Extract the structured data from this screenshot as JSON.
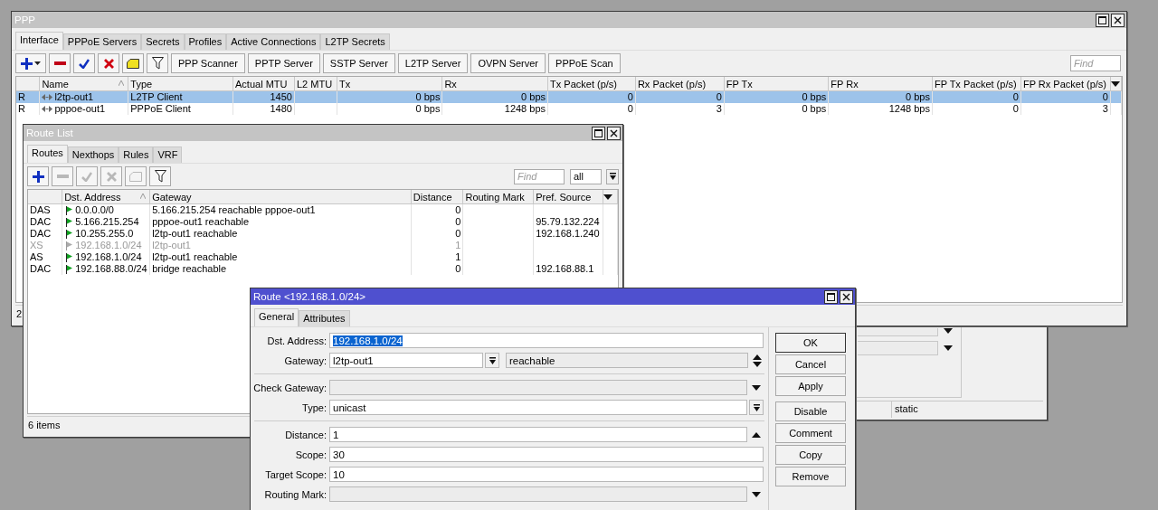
{
  "ppp_window": {
    "title": "PPP",
    "tabs": [
      {
        "label": "Interface",
        "selected": true
      },
      {
        "label": "PPPoE Servers",
        "selected": false
      },
      {
        "label": "Secrets",
        "selected": false
      },
      {
        "label": "Profiles",
        "selected": false
      },
      {
        "label": "Active Connections",
        "selected": false
      },
      {
        "label": "L2TP Secrets",
        "selected": false
      }
    ],
    "tools": [
      {
        "kind": "add_menu",
        "disabled": false
      },
      {
        "kind": "remove",
        "disabled": false
      },
      {
        "kind": "enable",
        "disabled": false
      },
      {
        "kind": "disable",
        "disabled": false
      },
      {
        "kind": "comment",
        "disabled": false
      },
      {
        "kind": "filter",
        "disabled": false
      }
    ],
    "buttons": [
      "PPP Scanner",
      "PPTP Server",
      "SSTP Server",
      "L2TP Server",
      "OVPN Server",
      "PPPoE Scan"
    ],
    "find": {
      "placeholder": "Find"
    },
    "table": {
      "columns": [
        {
          "label": "Name",
          "sorted": true
        },
        {
          "label": "Type",
          "sorted": false
        },
        {
          "label": "Actual MTU",
          "sorted": false
        },
        {
          "label": "L2 MTU",
          "sorted": false
        },
        {
          "label": "Tx",
          "sorted": false
        },
        {
          "label": "Rx",
          "sorted": false
        },
        {
          "label": "Tx Packet (p/s)",
          "sorted": false
        },
        {
          "label": "Rx Packet (p/s)",
          "sorted": false
        },
        {
          "label": "FP Tx",
          "sorted": false
        },
        {
          "label": "FP Rx",
          "sorted": false
        },
        {
          "label": "FP Tx Packet (p/s)",
          "sorted": false
        },
        {
          "label": "FP Rx Packet (p/s)",
          "sorted": false
        }
      ],
      "rows": [
        {
          "selected": true,
          "flag": "R",
          "name": "l2tp-out1",
          "type": "L2TP Client",
          "actual_mtu": "1450",
          "tx": "0 bps",
          "rx": "0 bps",
          "tx_packet": "0",
          "rx_packet": "0",
          "fp_tx": "0 bps",
          "fp_rx": "0 bps",
          "fp_tx_packet": "0",
          "fp_rx_packet": "0"
        },
        {
          "selected": false,
          "flag": "R",
          "name": "pppoe-out1",
          "type": "PPPoE Client",
          "actual_mtu": "1480",
          "tx": "0 bps",
          "rx": "1248 bps",
          "tx_packet": "0",
          "rx_packet": "3",
          "fp_tx": "0 bps",
          "fp_rx": "1248 bps",
          "fp_tx_packet": "0",
          "fp_rx_packet": "3"
        }
      ]
    },
    "status": "2"
  },
  "background_window": {
    "status": "static"
  },
  "route_list": {
    "title": "Route List",
    "tabs": [
      {
        "label": "Routes",
        "selected": true
      },
      {
        "label": "Nexthops",
        "selected": false
      },
      {
        "label": "Rules",
        "selected": false
      },
      {
        "label": "VRF",
        "selected": false
      }
    ],
    "tools": [
      {
        "kind": "add",
        "disabled": false
      },
      {
        "kind": "remove",
        "disabled": true
      },
      {
        "kind": "enable",
        "disabled": true
      },
      {
        "kind": "disable",
        "disabled": true
      },
      {
        "kind": "comment",
        "disabled": true
      },
      {
        "kind": "filter",
        "disabled": false
      }
    ],
    "find": {
      "placeholder": "Find"
    },
    "filter_value": "all",
    "table": {
      "columns": [
        {
          "label": "Dst. Address",
          "sorted": true
        },
        {
          "label": "Gateway",
          "sorted": false
        },
        {
          "label": "Distance",
          "sorted": false
        },
        {
          "label": "Routing Mark",
          "sorted": false
        },
        {
          "label": "Pref. Source",
          "sorted": false
        }
      ],
      "rows": [
        {
          "selected": false,
          "disabled": false,
          "flags": "DAS",
          "dst_address": "0.0.0.0/0",
          "gateway": "5.166.215.254 reachable pppoe-out1",
          "distance": "0"
        },
        {
          "selected": false,
          "disabled": false,
          "flags": "DAC",
          "dst_address": "5.166.215.254",
          "gateway": "pppoe-out1 reachable",
          "distance": "0",
          "pref_source": "95.79.132.224"
        },
        {
          "selected": false,
          "disabled": false,
          "flags": "DAC",
          "dst_address": "10.255.255.0",
          "gateway": "l2tp-out1 reachable",
          "distance": "0",
          "pref_source": "192.168.1.240"
        },
        {
          "selected": false,
          "disabled": true,
          "flags": "XS",
          "dst_address": "192.168.1.0/24",
          "gateway": "l2tp-out1",
          "distance": "1"
        },
        {
          "selected": false,
          "disabled": false,
          "flags": "AS",
          "dst_address": "192.168.1.0/24",
          "gateway": "l2tp-out1 reachable",
          "distance": "1"
        },
        {
          "selected": false,
          "disabled": false,
          "flags": "DAC",
          "dst_address": "192.168.88.0/24",
          "gateway": "bridge reachable",
          "distance": "0",
          "pref_source": "192.168.88.1"
        }
      ]
    },
    "status": "6 items"
  },
  "route_dialog": {
    "title": "Route <192.168.1.0/24>",
    "tabs": [
      {
        "label": "General",
        "selected": true
      },
      {
        "label": "Attributes",
        "selected": false
      }
    ],
    "fields": [
      {
        "kind": "text",
        "label": "Dst. Address:",
        "value": "192.168.1.0/24",
        "highlighted": true
      },
      {
        "kind": "gateway",
        "label": "Gateway:",
        "value": "l2tp-out1",
        "status": "reachable"
      },
      {
        "kind": "divider"
      },
      {
        "kind": "optional",
        "label": "Check Gateway:"
      },
      {
        "kind": "select",
        "label": "Type:",
        "value": "unicast"
      },
      {
        "kind": "divider"
      },
      {
        "kind": "optional_set",
        "label": "Distance:",
        "value": "1"
      },
      {
        "kind": "text",
        "label": "Scope:",
        "value": "30",
        "highlighted": false
      },
      {
        "kind": "text",
        "label": "Target Scope:",
        "value": "10",
        "highlighted": false
      },
      {
        "kind": "optional",
        "label": "Routing Mark:"
      }
    ],
    "button_groups": [
      [
        {
          "label": "OK",
          "default": true
        },
        {
          "label": "Cancel",
          "default": false
        },
        {
          "label": "Apply",
          "default": false
        }
      ],
      [
        {
          "label": "Disable",
          "default": false
        },
        {
          "label": "Comment",
          "default": false
        },
        {
          "label": "Copy",
          "default": false
        },
        {
          "label": "Remove",
          "default": false
        }
      ]
    ]
  }
}
